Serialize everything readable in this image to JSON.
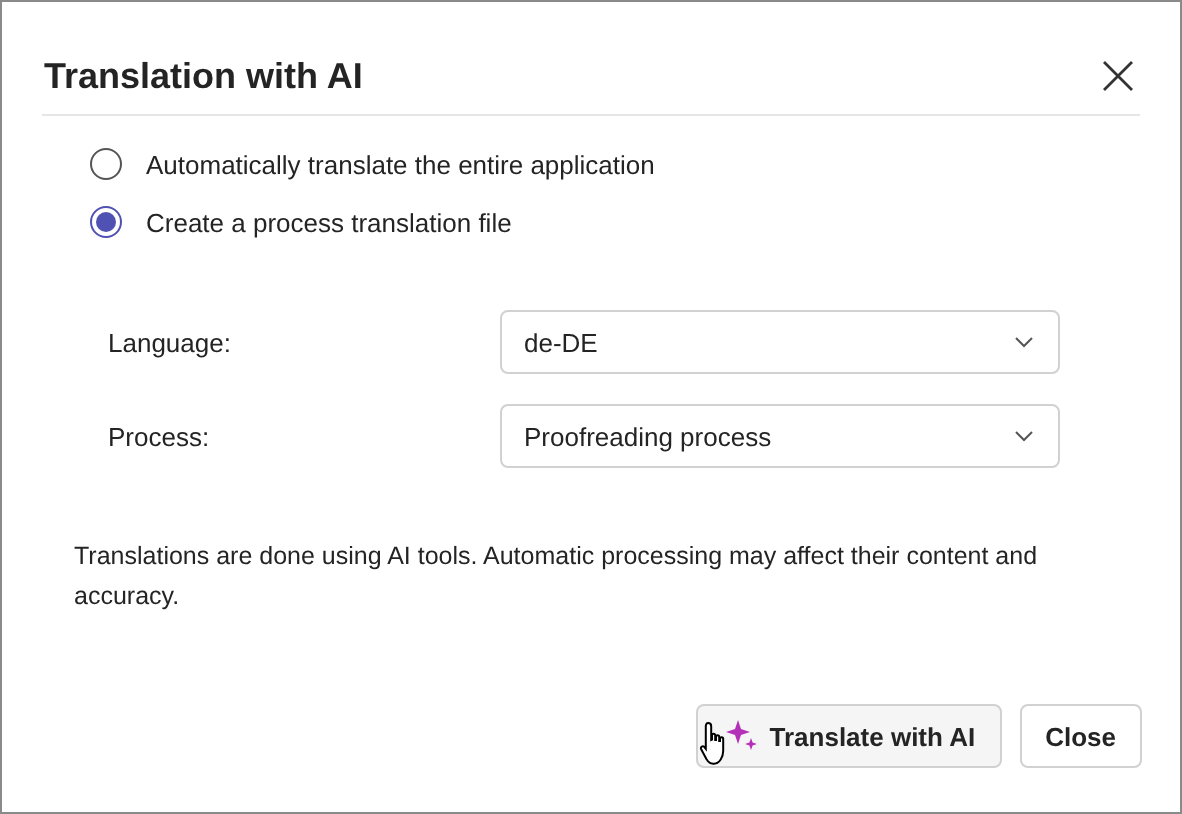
{
  "dialog": {
    "title": "Translation with AI"
  },
  "options": [
    {
      "label": "Automatically translate the entire application",
      "selected": false
    },
    {
      "label": "Create a process translation file",
      "selected": true
    }
  ],
  "fields": [
    {
      "label": "Language:",
      "value": "de-DE"
    },
    {
      "label": "Process:",
      "value": "Proofreading process"
    }
  ],
  "note": "Translations are done using AI tools. Automatic processing may affect their content and accuracy.",
  "buttons": [
    {
      "label": "Translate with AI",
      "kind": "ai"
    },
    {
      "label": "Close",
      "kind": "plain"
    }
  ]
}
